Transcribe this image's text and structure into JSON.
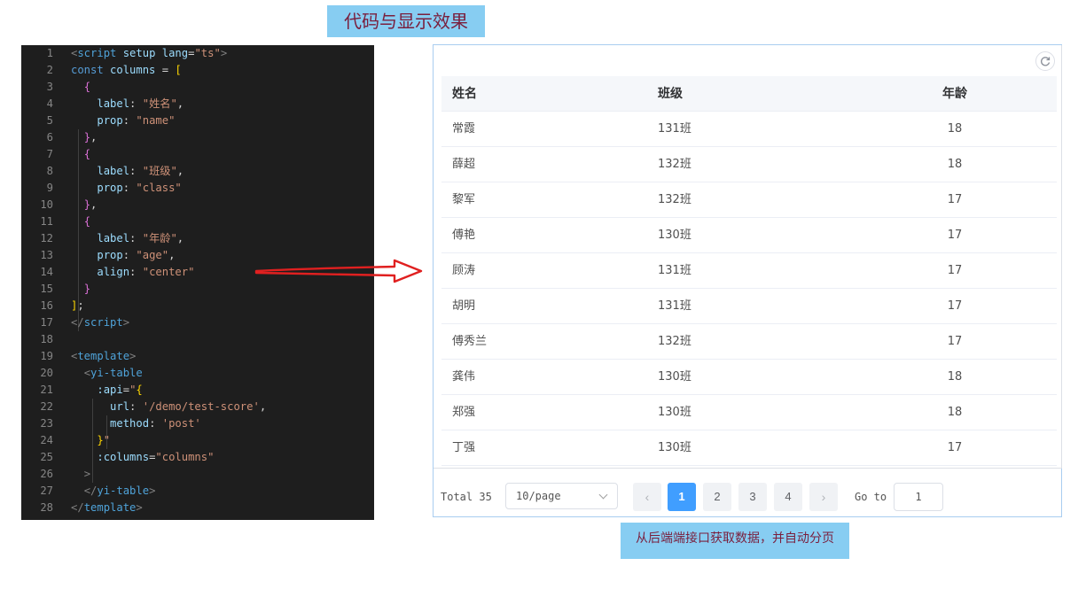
{
  "title_banner": "代码与显示效果",
  "caption_banner": "从后端端接口获取数据，并自动分页",
  "code_lines": [
    {
      "n": "1",
      "tokens": [
        [
          "t-punc",
          "<"
        ],
        [
          "t-tag",
          "script"
        ],
        [
          "t-plain",
          " "
        ],
        [
          "t-attr",
          "setup"
        ],
        [
          "t-plain",
          " "
        ],
        [
          "t-attr",
          "lang"
        ],
        [
          "t-plain",
          "="
        ],
        [
          "t-str",
          "\"ts\""
        ],
        [
          "t-punc",
          ">"
        ]
      ]
    },
    {
      "n": "2",
      "tokens": [
        [
          "t-kw",
          "const"
        ],
        [
          "t-plain",
          " "
        ],
        [
          "t-var",
          "columns"
        ],
        [
          "t-plain",
          " = "
        ],
        [
          "t-b1",
          "["
        ]
      ]
    },
    {
      "n": "3",
      "tokens": [
        [
          "t-plain",
          "  "
        ],
        [
          "t-b2",
          "{"
        ]
      ]
    },
    {
      "n": "4",
      "tokens": [
        [
          "t-plain",
          "    "
        ],
        [
          "t-attr",
          "label"
        ],
        [
          "t-plain",
          ": "
        ],
        [
          "t-str",
          "\"姓名\""
        ],
        [
          "t-plain",
          ","
        ]
      ]
    },
    {
      "n": "5",
      "tokens": [
        [
          "t-plain",
          "    "
        ],
        [
          "t-attr",
          "prop"
        ],
        [
          "t-plain",
          ": "
        ],
        [
          "t-str",
          "\"name\""
        ]
      ]
    },
    {
      "n": "6",
      "tokens": [
        [
          "t-plain",
          "  "
        ],
        [
          "t-b2",
          "}"
        ],
        [
          "t-plain",
          ","
        ]
      ]
    },
    {
      "n": "7",
      "tokens": [
        [
          "t-plain",
          "  "
        ],
        [
          "t-b2",
          "{"
        ]
      ]
    },
    {
      "n": "8",
      "tokens": [
        [
          "t-plain",
          "    "
        ],
        [
          "t-attr",
          "label"
        ],
        [
          "t-plain",
          ": "
        ],
        [
          "t-str",
          "\"班级\""
        ],
        [
          "t-plain",
          ","
        ]
      ]
    },
    {
      "n": "9",
      "tokens": [
        [
          "t-plain",
          "    "
        ],
        [
          "t-attr",
          "prop"
        ],
        [
          "t-plain",
          ": "
        ],
        [
          "t-str",
          "\"class\""
        ]
      ]
    },
    {
      "n": "10",
      "tokens": [
        [
          "t-plain",
          "  "
        ],
        [
          "t-b2",
          "}"
        ],
        [
          "t-plain",
          ","
        ]
      ]
    },
    {
      "n": "11",
      "tokens": [
        [
          "t-plain",
          "  "
        ],
        [
          "t-b2",
          "{"
        ]
      ]
    },
    {
      "n": "12",
      "tokens": [
        [
          "t-plain",
          "    "
        ],
        [
          "t-attr",
          "label"
        ],
        [
          "t-plain",
          ": "
        ],
        [
          "t-str",
          "\"年龄\""
        ],
        [
          "t-plain",
          ","
        ]
      ]
    },
    {
      "n": "13",
      "tokens": [
        [
          "t-plain",
          "    "
        ],
        [
          "t-attr",
          "prop"
        ],
        [
          "t-plain",
          ": "
        ],
        [
          "t-str",
          "\"age\""
        ],
        [
          "t-plain",
          ","
        ]
      ]
    },
    {
      "n": "14",
      "tokens": [
        [
          "t-plain",
          "    "
        ],
        [
          "t-attr",
          "align"
        ],
        [
          "t-plain",
          ": "
        ],
        [
          "t-str",
          "\"center\""
        ]
      ]
    },
    {
      "n": "15",
      "tokens": [
        [
          "t-plain",
          "  "
        ],
        [
          "t-b2",
          "}"
        ]
      ]
    },
    {
      "n": "16",
      "tokens": [
        [
          "t-b1",
          "]"
        ],
        [
          "t-plain",
          ";"
        ]
      ]
    },
    {
      "n": "17",
      "tokens": [
        [
          "t-punc",
          "</"
        ],
        [
          "t-tag",
          "script"
        ],
        [
          "t-punc",
          ">"
        ]
      ]
    },
    {
      "n": "18",
      "tokens": []
    },
    {
      "n": "19",
      "tokens": [
        [
          "t-punc",
          "<"
        ],
        [
          "t-tag",
          "template"
        ],
        [
          "t-punc",
          ">"
        ]
      ]
    },
    {
      "n": "20",
      "tokens": [
        [
          "t-plain",
          "  "
        ],
        [
          "t-punc",
          "<"
        ],
        [
          "t-tag",
          "yi-table"
        ]
      ]
    },
    {
      "n": "21",
      "tokens": [
        [
          "t-plain",
          "    "
        ],
        [
          "t-attr",
          ":api"
        ],
        [
          "t-plain",
          "="
        ],
        [
          "t-str",
          "\""
        ],
        [
          "t-b1",
          "{"
        ]
      ]
    },
    {
      "n": "22",
      "tokens": [
        [
          "t-plain",
          "      "
        ],
        [
          "t-attr",
          "url"
        ],
        [
          "t-plain",
          ": "
        ],
        [
          "t-str",
          "'/demo/test-score'"
        ],
        [
          "t-plain",
          ","
        ]
      ]
    },
    {
      "n": "23",
      "tokens": [
        [
          "t-plain",
          "      "
        ],
        [
          "t-attr",
          "method"
        ],
        [
          "t-plain",
          ": "
        ],
        [
          "t-str",
          "'post'"
        ]
      ]
    },
    {
      "n": "24",
      "tokens": [
        [
          "t-plain",
          "    "
        ],
        [
          "t-b1",
          "}"
        ],
        [
          "t-str",
          "\""
        ]
      ]
    },
    {
      "n": "25",
      "tokens": [
        [
          "t-plain",
          "    "
        ],
        [
          "t-attr",
          ":columns"
        ],
        [
          "t-plain",
          "="
        ],
        [
          "t-str",
          "\"columns\""
        ]
      ]
    },
    {
      "n": "26",
      "tokens": [
        [
          "t-plain",
          "  "
        ],
        [
          "t-punc",
          ">"
        ]
      ]
    },
    {
      "n": "27",
      "tokens": [
        [
          "t-plain",
          "  "
        ],
        [
          "t-punc",
          "</"
        ],
        [
          "t-tag",
          "yi-table"
        ],
        [
          "t-punc",
          ">"
        ]
      ]
    },
    {
      "n": "28",
      "tokens": [
        [
          "t-punc",
          "</"
        ],
        [
          "t-tag",
          "template"
        ],
        [
          "t-punc",
          ">"
        ]
      ]
    }
  ],
  "table": {
    "columns": [
      "姓名",
      "班级",
      "年龄"
    ],
    "rows": [
      [
        "常霞",
        "131班",
        "18"
      ],
      [
        "薛超",
        "132班",
        "18"
      ],
      [
        "黎军",
        "132班",
        "17"
      ],
      [
        "傅艳",
        "130班",
        "17"
      ],
      [
        "顾涛",
        "131班",
        "17"
      ],
      [
        "胡明",
        "131班",
        "17"
      ],
      [
        "傅秀兰",
        "132班",
        "17"
      ],
      [
        "龚伟",
        "130班",
        "18"
      ],
      [
        "郑强",
        "130班",
        "18"
      ],
      [
        "丁强",
        "130班",
        "17"
      ]
    ]
  },
  "pagination": {
    "total_label": "Total 35",
    "page_size": "10/page",
    "prev": "‹",
    "next": "›",
    "pages": [
      "1",
      "2",
      "3",
      "4"
    ],
    "current_page": "1",
    "goto_label": "Go to",
    "goto_value": "1"
  },
  "icons": {
    "refresh": "refresh-icon",
    "arrow": "red-arrow"
  },
  "colors": {
    "accent": "#409eff",
    "banner": "#87cdf2",
    "banner_text": "#7a1f3d",
    "arrow": "#e02020",
    "editor_bg": "#1e1e1e"
  }
}
